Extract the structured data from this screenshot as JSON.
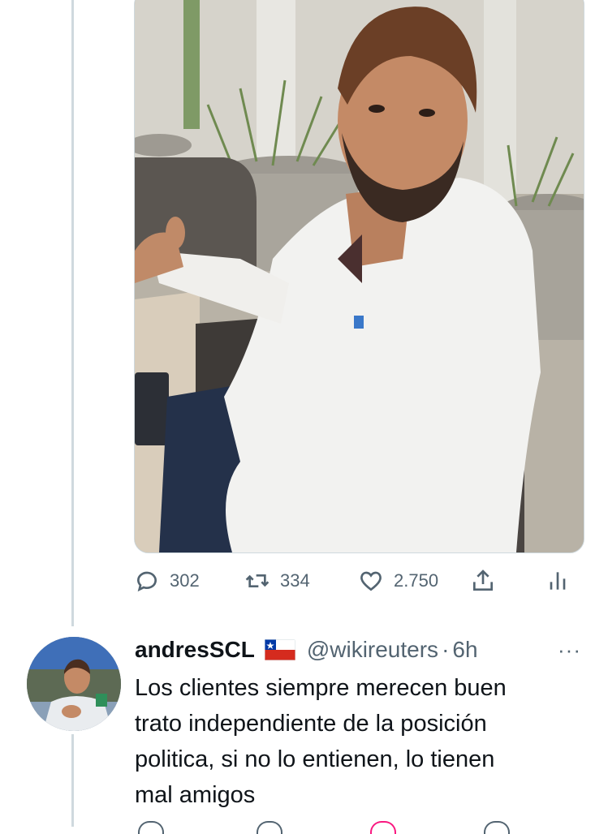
{
  "tweet": {
    "media": {
      "alt_icon": "photo-image"
    },
    "actions": {
      "reply_count": "302",
      "retweet_count": "334",
      "like_count": "2.750"
    }
  },
  "reply": {
    "display_name": "andresSCL",
    "flag_icon": "chile-flag-icon",
    "handle": "@wikireuters",
    "separator": "·",
    "time": "6h",
    "more": "···",
    "text_lines": [
      "Los clientes siempre merecen buen",
      "trato independiente de la posición",
      "politica, si no lo entienen, lo tienen",
      "mal amigos"
    ]
  },
  "colors": {
    "secondary_text": "#536471",
    "border": "#cfd9de",
    "like_pink": "#f91880"
  }
}
